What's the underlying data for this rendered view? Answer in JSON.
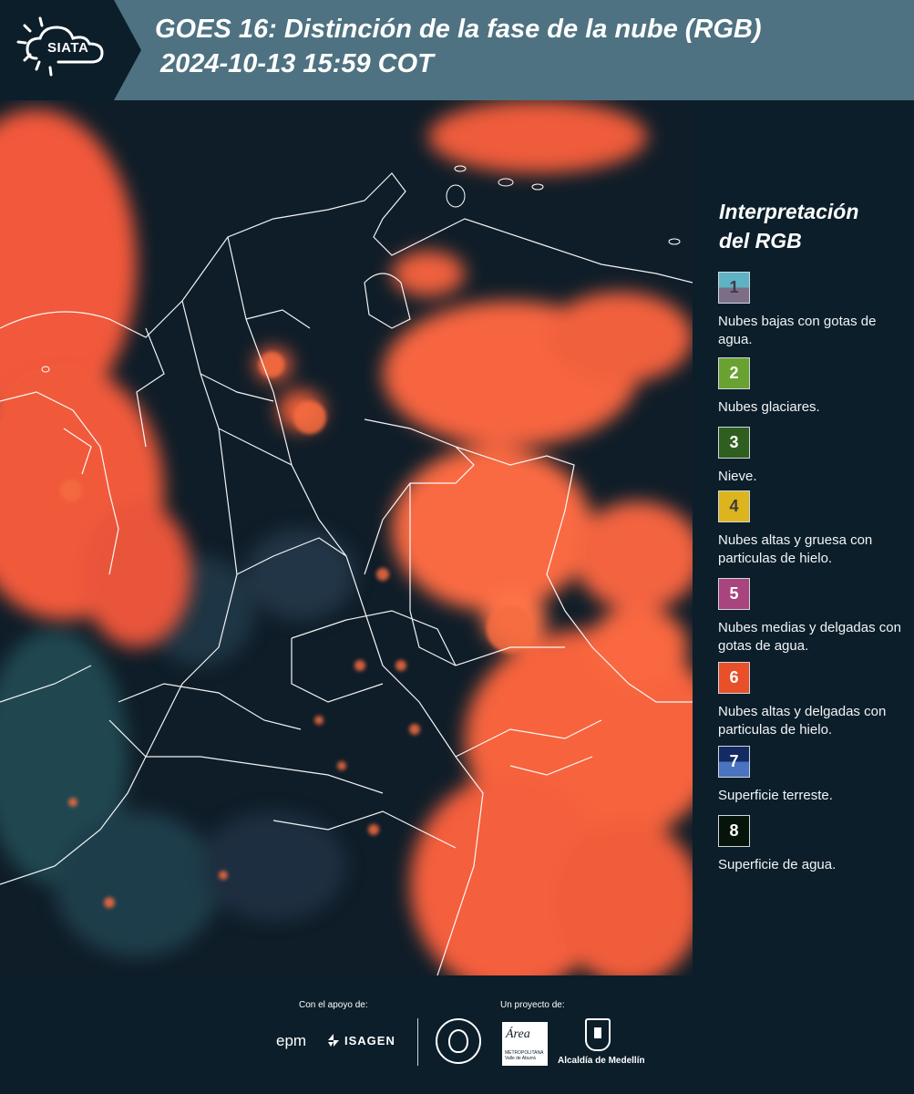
{
  "header": {
    "logo_text": "SIATA",
    "title_line1": "GOES 16: Distinción de la fase de la nube (RGB)",
    "title_line2": "2024-10-13 15:59 COT"
  },
  "legend": {
    "title_line1": "Interpretación",
    "title_line2": "del RGB",
    "items": [
      {
        "number": "1",
        "text": "Nubes bajas con gotas de agua.",
        "color_top": "#5fb2c3",
        "color_bottom": "#7d6e88"
      },
      {
        "number": "2",
        "text": "Nubes glaciares.",
        "color": "#6aa232"
      },
      {
        "number": "3",
        "text": "Nieve.",
        "color": "#2f5f1e"
      },
      {
        "number": "4",
        "text": "Nubes altas y gruesa con particulas de hielo.",
        "color": "#dcb41e"
      },
      {
        "number": "5",
        "text": "Nubes medias y delgadas con gotas de agua.",
        "color": "#a9447e"
      },
      {
        "number": "6",
        "text": "Nubes altas y delgadas con particulas de hielo.",
        "color": "#e9502a"
      },
      {
        "number": "7",
        "text": "Superficie terreste.",
        "color_top": "#142a63",
        "color_bottom": "#4a73c0"
      },
      {
        "number": "8",
        "text": "Superficie de agua.",
        "color": "#06140a"
      }
    ]
  },
  "footer": {
    "support_label": "Con el apoyo de:",
    "project_label": "Un proyecto de:",
    "sponsor_1": "epm",
    "sponsor_2": "ISAGEN",
    "area_logo_text": "Área",
    "area_logo_sub": "METROPOLITANA Valle de Aburrá",
    "alcaldia": "Alcaldía de Medellín"
  },
  "colors": {
    "header_bg": "#4e7281",
    "panel_bg": "#0b1e2a",
    "cloud_orange": "#ff6a3c",
    "surface_dark": "#0f1d28"
  }
}
